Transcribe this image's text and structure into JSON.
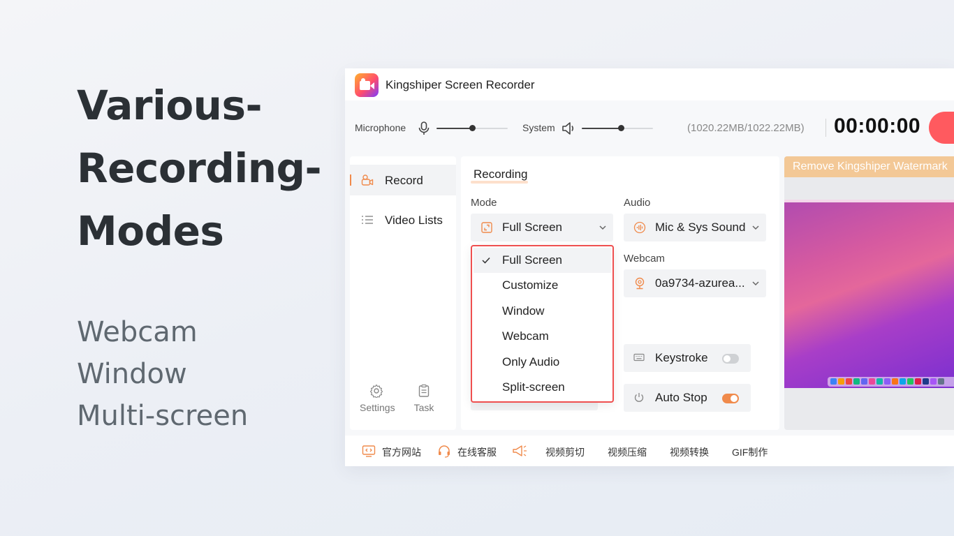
{
  "promo": {
    "title_lines": [
      "Various-",
      "Recording-",
      "Modes"
    ],
    "features": [
      "Webcam",
      "Window",
      "Multi-screen"
    ]
  },
  "app": {
    "title": "Kingshiper Screen Recorder",
    "icon": "app-logo-camera-icon"
  },
  "controls": {
    "microphone_label": "Microphone",
    "microphone_level": 0.5,
    "system_label": "System",
    "system_level": 0.55,
    "storage": "(1020.22MB/1022.22MB)",
    "timer": "00:00:00",
    "record_color": "#ff5a5f"
  },
  "sidebar": {
    "items": [
      {
        "label": "Record",
        "icon": "camera-icon",
        "active": true
      },
      {
        "label": "Video Lists",
        "icon": "list-icon",
        "active": false
      }
    ],
    "bottom": [
      {
        "label": "Settings",
        "icon": "gear-icon"
      },
      {
        "label": "Task",
        "icon": "clipboard-icon"
      }
    ]
  },
  "panel": {
    "title": "Recording",
    "mode_label": "Mode",
    "mode_value": "Full Screen",
    "audio_label": "Audio",
    "audio_value": "Mic & Sys Sound",
    "webcam_label": "Webcam",
    "webcam_value": "0a9734-azurea...",
    "keystroke_label": "Keystroke",
    "keystroke_on": false,
    "autostop_label": "Auto Stop",
    "autostop_on": true
  },
  "mode_dropdown": {
    "options": [
      "Full Screen",
      "Customize",
      "Window",
      "Webcam",
      "Only Audio",
      "Split-screen"
    ],
    "selected": "Full Screen"
  },
  "preview": {
    "watermark_text": "Remove Kingshiper Watermark"
  },
  "footer": {
    "items": [
      "官方网站",
      "在线客服",
      "视频剪切",
      "视频压缩",
      "视频转换",
      "GIF制作"
    ]
  },
  "colors": {
    "accent": "#f08a4b",
    "dropdown_border": "#ef4f4f",
    "watermark_bar": "#f3c896"
  }
}
